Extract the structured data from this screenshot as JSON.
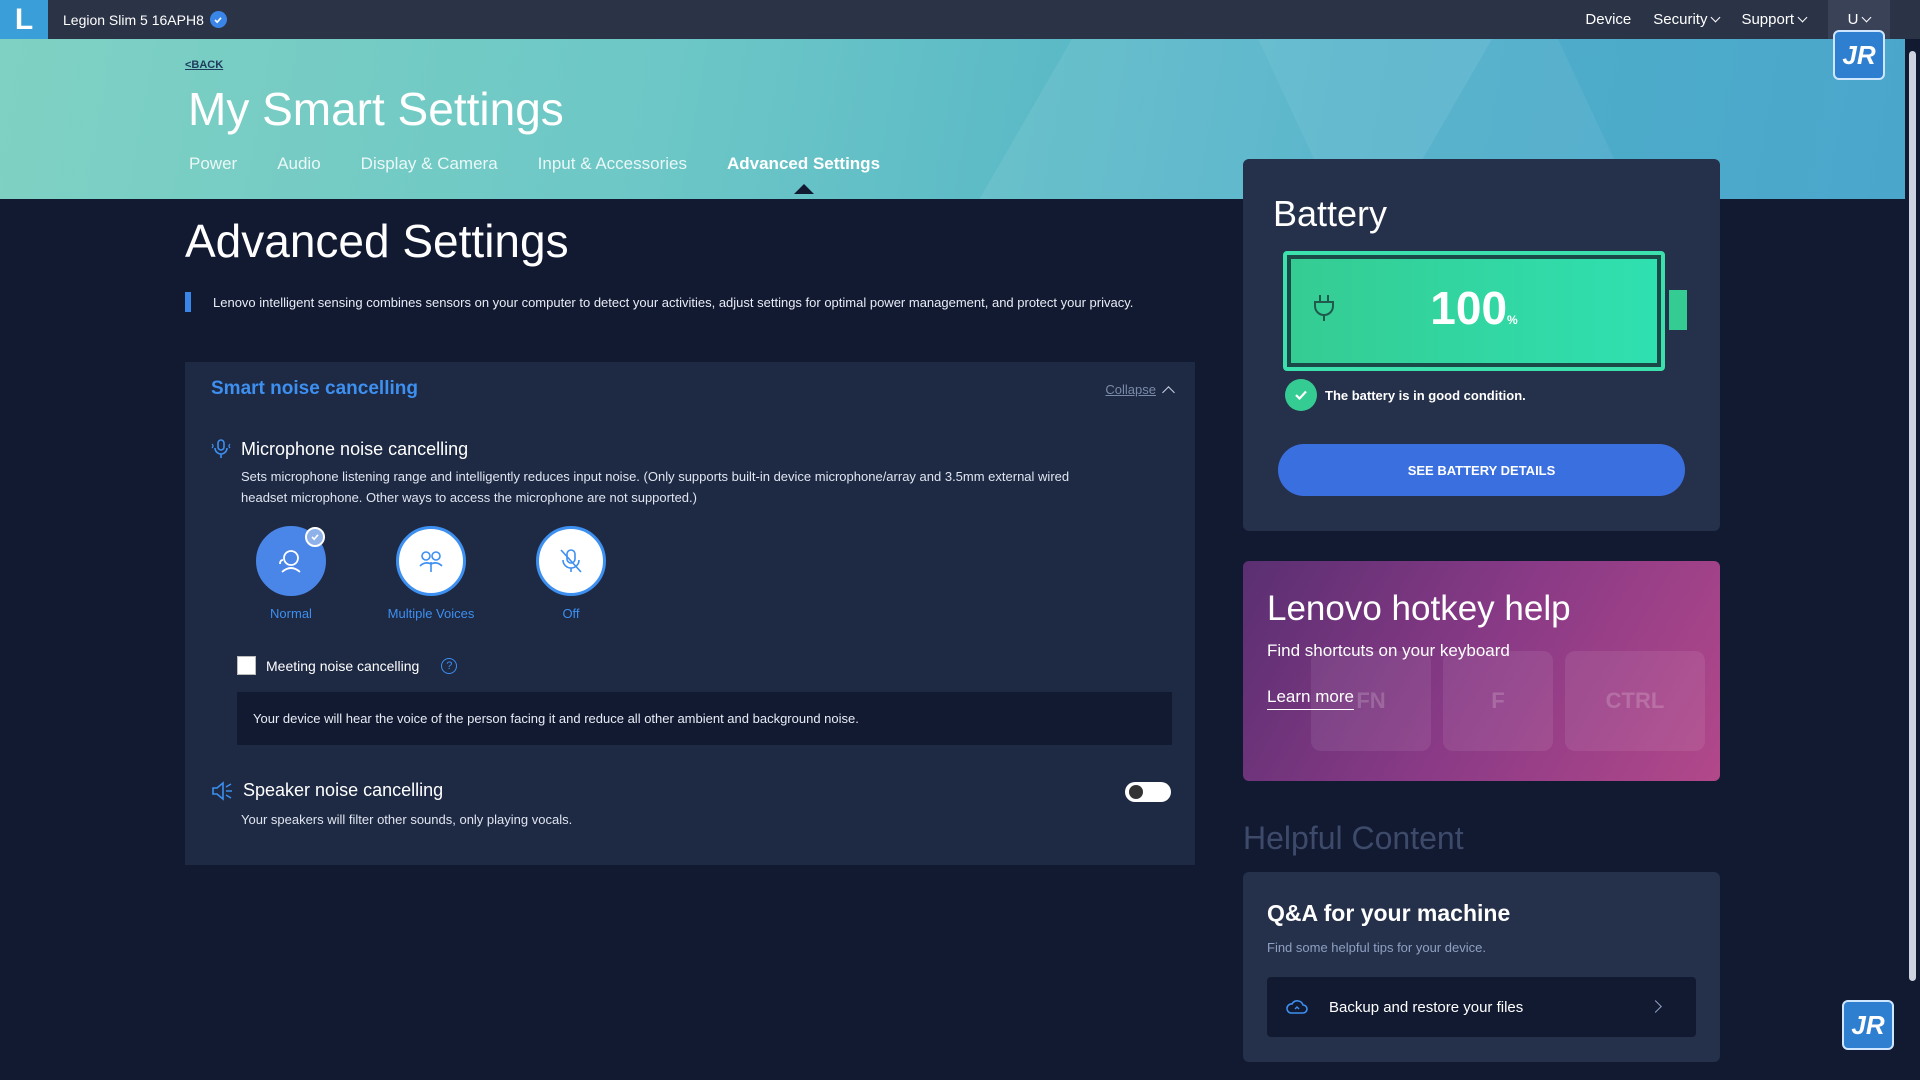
{
  "topbar": {
    "logo": "L",
    "device_name": "Legion Slim 5 16APH8",
    "nav": [
      {
        "label": "Device",
        "has_dropdown": false
      },
      {
        "label": "Security",
        "has_dropdown": true
      },
      {
        "label": "Support",
        "has_dropdown": true
      }
    ],
    "user_initial": "U"
  },
  "hero": {
    "back_label": "<BACK",
    "title": "My Smart Settings",
    "tabs": [
      {
        "label": "Power",
        "active": false
      },
      {
        "label": "Audio",
        "active": false
      },
      {
        "label": "Display & Camera",
        "active": false
      },
      {
        "label": "Input & Accessories",
        "active": false
      },
      {
        "label": "Advanced Settings",
        "active": true
      }
    ]
  },
  "main": {
    "title": "Advanced Settings",
    "intro": "Lenovo intelligent sensing combines sensors on your computer to detect your activities, adjust settings for optimal power management, and protect your privacy.",
    "panel": {
      "title": "Smart noise cancelling",
      "collapse_label": "Collapse",
      "microphone": {
        "title": "Microphone noise cancelling",
        "description": "Sets microphone listening range and intelligently reduces input noise. (Only supports built-in device microphone/array and 3.5mm external wired headset microphone. Other ways to access the microphone are not supported.)",
        "options": [
          {
            "label": "Normal",
            "selected": true
          },
          {
            "label": "Multiple Voices",
            "selected": false
          },
          {
            "label": "Off",
            "selected": false
          }
        ]
      },
      "meeting": {
        "label": "Meeting noise cancelling",
        "checked": false,
        "help": "?",
        "info": "Your device will hear the voice of the person facing it and reduce all other ambient and background noise."
      },
      "speaker": {
        "title": "Speaker noise cancelling",
        "description": "Your speakers will filter other sounds, only playing vocals.",
        "enabled": false
      }
    }
  },
  "battery": {
    "title": "Battery",
    "percent": "100",
    "unit": "%",
    "status": "The battery is in good condition.",
    "button_label": "SEE BATTERY DETAILS"
  },
  "hotkey": {
    "title": "Lenovo hotkey help",
    "subtitle": "Find shortcuts on your keyboard",
    "link": "Learn more",
    "keys": [
      "FN",
      "F",
      "CTRL"
    ]
  },
  "helpful": {
    "heading": "Helpful Content",
    "qa": {
      "title": "Q&A for your machine",
      "subtitle": "Find some helpful tips for your device.",
      "item": "Backup and restore your files"
    }
  },
  "watermark": "JR",
  "colors": {
    "accent": "#3d8ff0",
    "background": "#121a32",
    "battery_green": "#35cc93",
    "button_blue": "#3a6fe0"
  }
}
